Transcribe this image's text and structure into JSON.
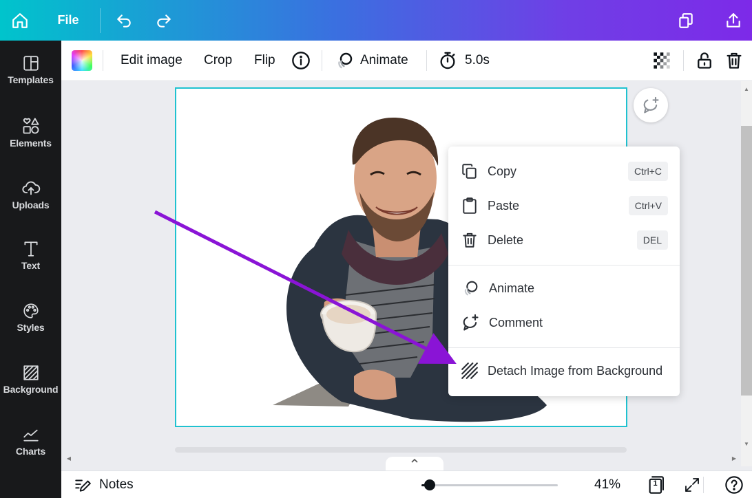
{
  "topbar": {
    "file_label": "File"
  },
  "sidebar": {
    "items": [
      {
        "label": "Templates",
        "icon": "templates-icon"
      },
      {
        "label": "Elements",
        "icon": "elements-icon"
      },
      {
        "label": "Uploads",
        "icon": "uploads-icon"
      },
      {
        "label": "Text",
        "icon": "text-icon"
      },
      {
        "label": "Styles",
        "icon": "styles-icon"
      },
      {
        "label": "Background",
        "icon": "background-icon"
      },
      {
        "label": "Charts",
        "icon": "charts-icon"
      }
    ]
  },
  "toolbar": {
    "edit_image_label": "Edit image",
    "crop_label": "Crop",
    "flip_label": "Flip",
    "animate_label": "Animate",
    "duration_label": "5.0s"
  },
  "context_menu": {
    "copy_label": "Copy",
    "copy_shortcut": "Ctrl+C",
    "paste_label": "Paste",
    "paste_shortcut": "Ctrl+V",
    "delete_label": "Delete",
    "delete_shortcut": "DEL",
    "animate_label": "Animate",
    "comment_label": "Comment",
    "detach_label": "Detach Image from Background"
  },
  "bottombar": {
    "notes_label": "Notes",
    "zoom_label": "41%",
    "zoom_fraction": 0.06,
    "page_number": "1"
  },
  "colors": {
    "accent_cyan": "#1fc2d0",
    "annotation_arrow": "#8a14d6",
    "sidebar_bg": "#18191b"
  }
}
